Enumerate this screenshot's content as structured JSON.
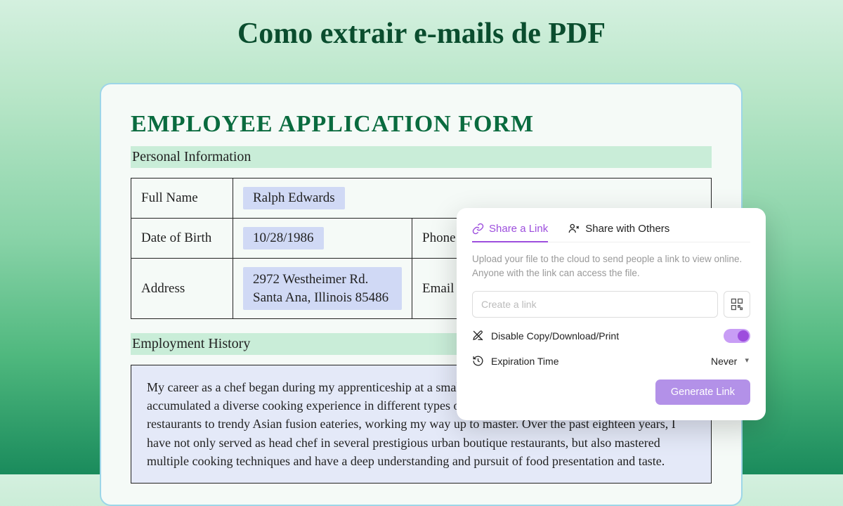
{
  "page_title": "Como extrair e-mails de PDF",
  "document": {
    "heading": "EMPLOYEE APPLICATION FORM",
    "section_personal": "Personal Information",
    "section_history": "Employment History",
    "fields": {
      "full_name_label": "Full Name",
      "full_name_value": "Ralph Edwards",
      "dob_label": "Date of Birth",
      "dob_value": "10/28/1986",
      "phone_label": "Phone",
      "address_label": "Address",
      "address_line1": "2972 Westheimer Rd.",
      "address_line2": "Santa Ana, Illinois 85486",
      "email_label": "Email"
    },
    "history_text": "My career as a chef began during my apprenticeship at a small local restaurant at the age of sixteen. I have accumulated a diverse cooking experience in different types of restaurants, from traditional Italian restaurants to trendy Asian fusion eateries, working my way up to master. Over the past eighteen years, I have not only served as head chef in several prestigious urban boutique restaurants, but also mastered multiple cooking techniques and have a deep understanding and pursuit of food presentation and taste."
  },
  "share_popup": {
    "tab_link": "Share a Link",
    "tab_others": "Share with Others",
    "description": "Upload your file to the cloud to send people a link to view online. Anyone with the link can access the file.",
    "link_placeholder": "Create a link",
    "disable_label": "Disable Copy/Download/Print",
    "expiration_label": "Expiration Time",
    "expiration_value": "Never",
    "generate_button": "Generate Link"
  }
}
